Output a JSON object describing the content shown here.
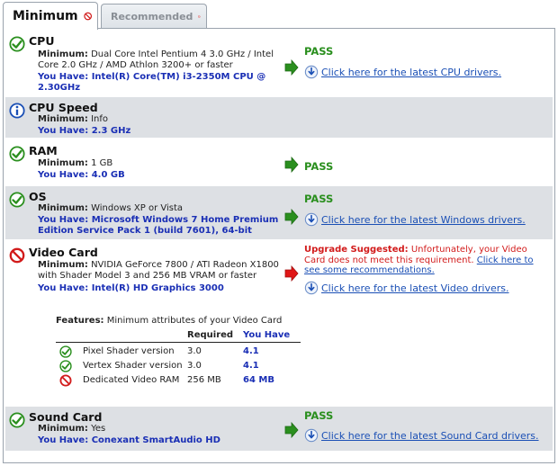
{
  "tabs": [
    {
      "label": "Minimum",
      "active": true,
      "icon": "no-icon"
    },
    {
      "label": "Recommended",
      "active": false,
      "icon": "no-icon"
    }
  ],
  "minimum_label": "Minimum:",
  "you_have_label": "You Have:",
  "pass_label": "PASS",
  "colors": {
    "pass": "#2a8f1e",
    "fail": "#d21b1b",
    "have": "#1a2fb5",
    "shade": "#dde0e4"
  },
  "cpu": {
    "title": "CPU",
    "minimum": "Dual Core Intel Pentium 4 3.0 GHz / Intel Core 2.0 GHz / AMD Athlon 3200+ or faster",
    "have": "Intel(R) Core(TM) i3-2350M CPU @ 2.30GHz",
    "link": "Click here for the latest CPU drivers."
  },
  "cpu_speed": {
    "title": "CPU Speed",
    "minimum": "Info",
    "have": "2.3 GHz"
  },
  "ram": {
    "title": "RAM",
    "minimum": "1 GB",
    "have": "4.0 GB"
  },
  "os": {
    "title": "OS",
    "minimum": "Windows XP or Vista",
    "have": "Microsoft Windows 7 Home Premium Edition Service Pack 1 (build 7601), 64-bit",
    "link": "Click here for the latest Windows drivers."
  },
  "video": {
    "title": "Video Card",
    "minimum": "NVIDIA GeForce 7800 / ATI Radeon X1800 with Shader Model 3 and 256 MB VRAM or faster",
    "have": "Intel(R) HD Graphics 3000",
    "upgrade_label": "Upgrade Suggested:",
    "upgrade_text": "Unfortunately, your Video Card does not meet this requirement.",
    "upgrade_link": "Click here to see some recommendations.",
    "link": "Click here for the latest Video drivers.",
    "features_label": "Features:",
    "features_text": "Minimum attributes of your Video Card",
    "col_required": "Required",
    "col_have": "You Have",
    "features": [
      {
        "name": "Pixel Shader version",
        "required": "3.0",
        "have": "4.1",
        "status": "pass"
      },
      {
        "name": "Vertex Shader version",
        "required": "3.0",
        "have": "4.1",
        "status": "pass"
      },
      {
        "name": "Dedicated Video RAM",
        "required": "256 MB",
        "have": "64 MB",
        "status": "fail"
      }
    ]
  },
  "sound": {
    "title": "Sound Card",
    "minimum": "Yes",
    "have": "Conexant SmartAudio HD",
    "link": "Click here for the latest Sound Card drivers."
  }
}
